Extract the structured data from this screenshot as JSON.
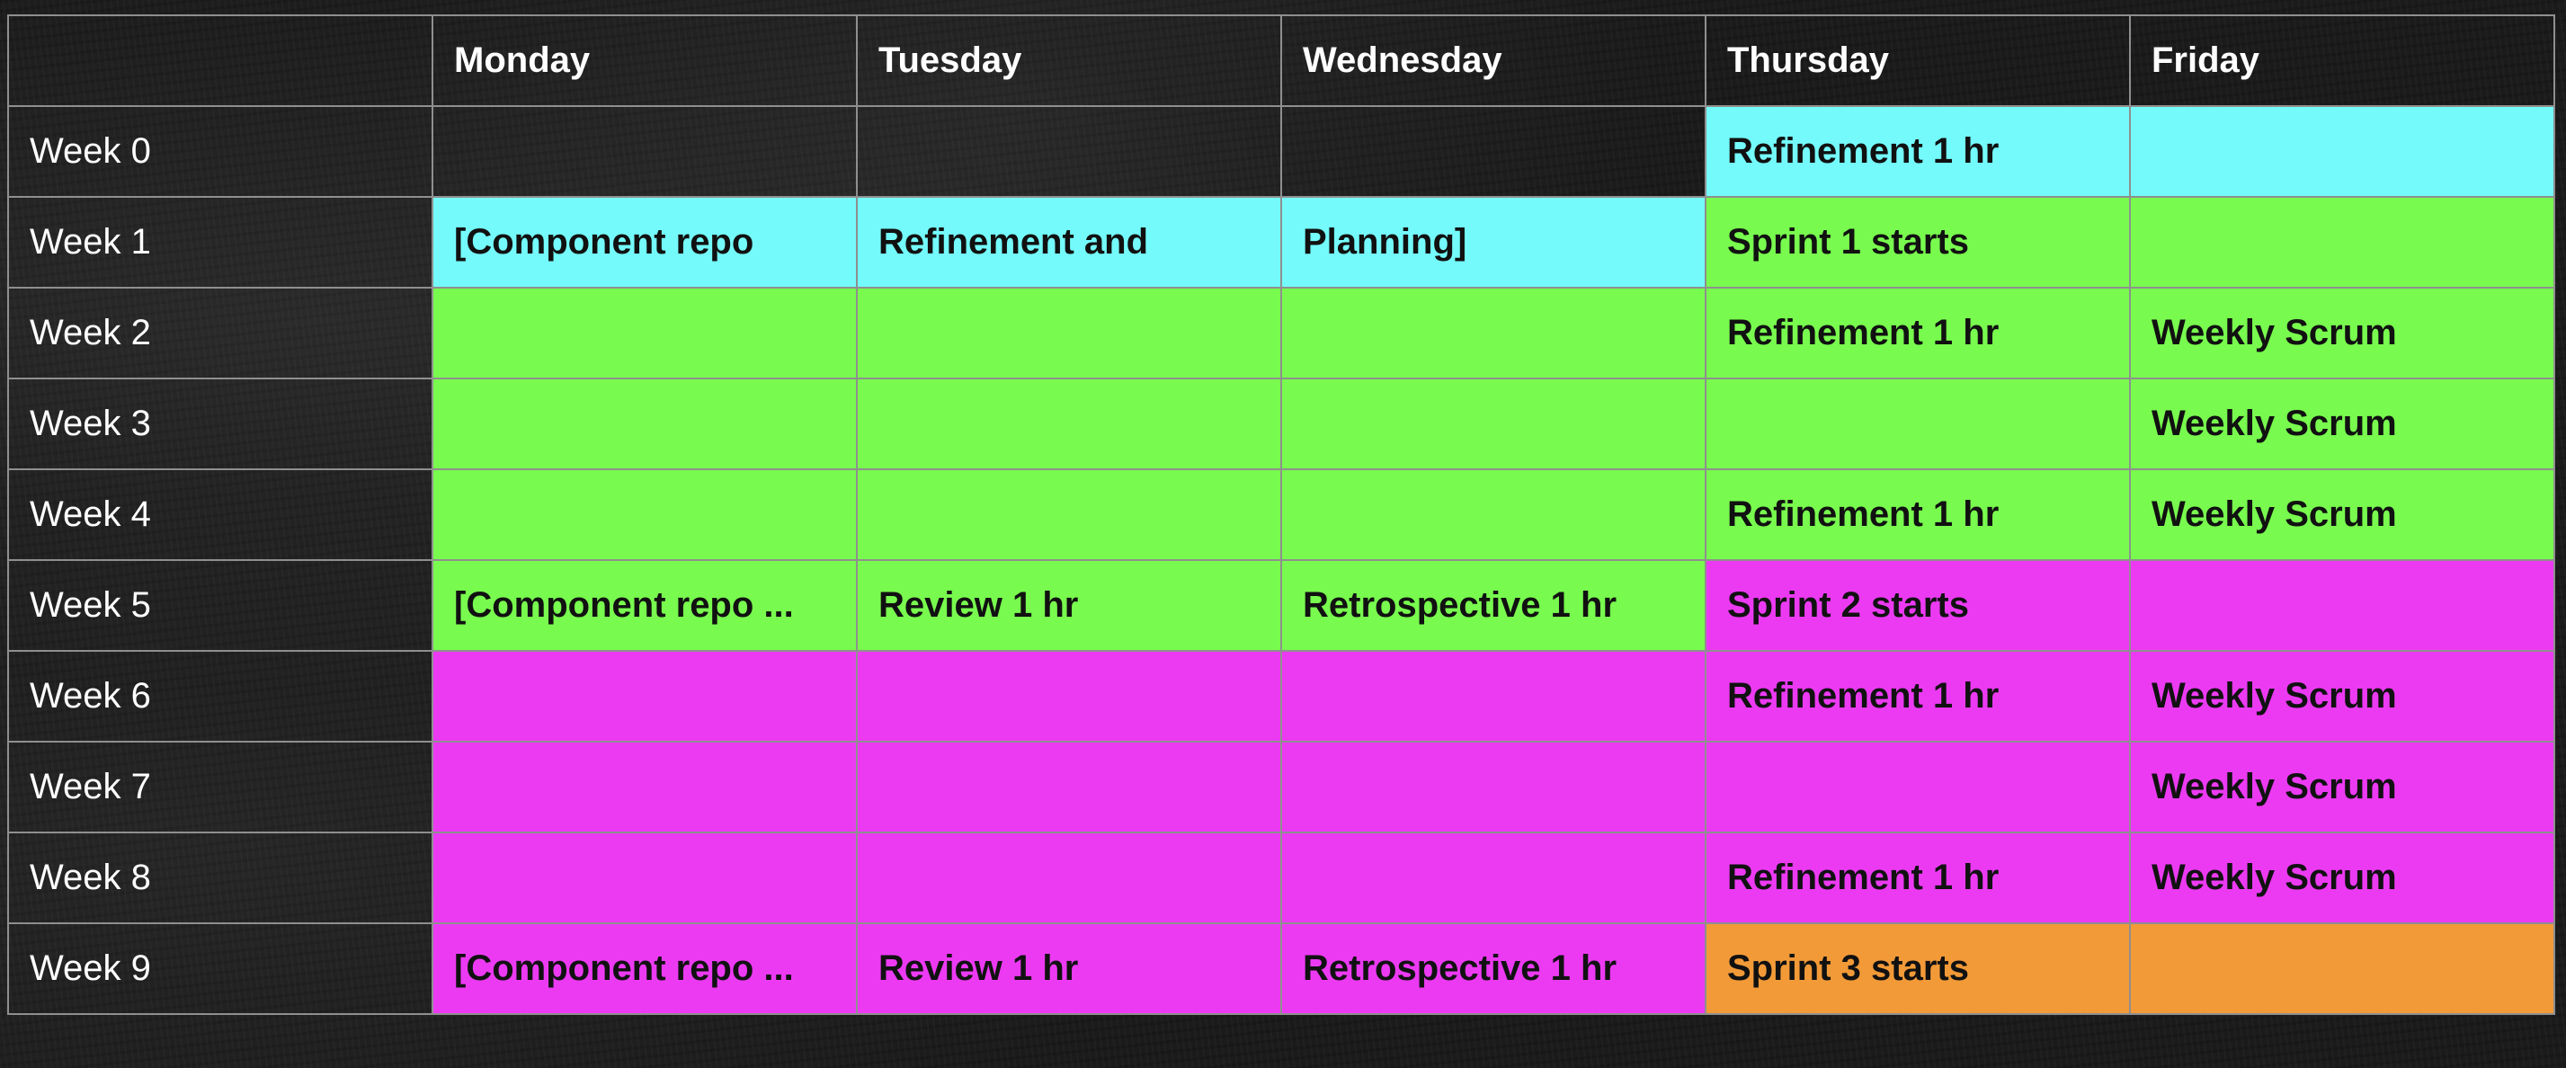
{
  "colors": {
    "empty": "transparent",
    "cyan": "#74fafa",
    "green": "#78fb4e",
    "magenta": "#ec3af3",
    "orange": "#f29a38"
  },
  "header": {
    "corner": "",
    "days": [
      "Monday",
      "Tuesday",
      "Wednesday",
      "Thursday",
      "Friday"
    ]
  },
  "rows": [
    {
      "label": "Week 0",
      "cells": [
        {
          "text": "",
          "color": "empty"
        },
        {
          "text": "",
          "color": "empty"
        },
        {
          "text": "",
          "color": "empty"
        },
        {
          "text": "Refinement 1 hr",
          "color": "cyan"
        },
        {
          "text": "",
          "color": "cyan"
        }
      ]
    },
    {
      "label": "Week 1",
      "cells": [
        {
          "text": "[Component repo",
          "color": "cyan"
        },
        {
          "text": "Refinement and",
          "color": "cyan"
        },
        {
          "text": "Planning]",
          "color": "cyan"
        },
        {
          "text": "Sprint 1 starts",
          "color": "green"
        },
        {
          "text": "",
          "color": "green"
        }
      ]
    },
    {
      "label": "Week 2",
      "cells": [
        {
          "text": "",
          "color": "green"
        },
        {
          "text": "",
          "color": "green"
        },
        {
          "text": "",
          "color": "green"
        },
        {
          "text": "Refinement 1 hr",
          "color": "green"
        },
        {
          "text": "Weekly Scrum",
          "color": "green"
        }
      ]
    },
    {
      "label": "Week 3",
      "cells": [
        {
          "text": "",
          "color": "green"
        },
        {
          "text": "",
          "color": "green"
        },
        {
          "text": "",
          "color": "green"
        },
        {
          "text": "",
          "color": "green"
        },
        {
          "text": "Weekly Scrum",
          "color": "green"
        }
      ]
    },
    {
      "label": "Week 4",
      "cells": [
        {
          "text": "",
          "color": "green"
        },
        {
          "text": "",
          "color": "green"
        },
        {
          "text": "",
          "color": "green"
        },
        {
          "text": "Refinement 1 hr",
          "color": "green"
        },
        {
          "text": "Weekly Scrum",
          "color": "green"
        }
      ]
    },
    {
      "label": "Week 5",
      "cells": [
        {
          "text": "[Component repo ...",
          "color": "green"
        },
        {
          "text": "Review 1 hr",
          "color": "green"
        },
        {
          "text": "Retrospective 1 hr",
          "color": "green"
        },
        {
          "text": "Sprint 2 starts",
          "color": "magenta"
        },
        {
          "text": "",
          "color": "magenta"
        }
      ]
    },
    {
      "label": "Week 6",
      "cells": [
        {
          "text": "",
          "color": "magenta"
        },
        {
          "text": "",
          "color": "magenta"
        },
        {
          "text": "",
          "color": "magenta"
        },
        {
          "text": "Refinement 1 hr",
          "color": "magenta"
        },
        {
          "text": "Weekly Scrum",
          "color": "magenta"
        }
      ]
    },
    {
      "label": "Week 7",
      "cells": [
        {
          "text": "",
          "color": "magenta"
        },
        {
          "text": "",
          "color": "magenta"
        },
        {
          "text": "",
          "color": "magenta"
        },
        {
          "text": "",
          "color": "magenta"
        },
        {
          "text": "Weekly Scrum",
          "color": "magenta"
        }
      ]
    },
    {
      "label": "Week 8",
      "cells": [
        {
          "text": "",
          "color": "magenta"
        },
        {
          "text": "",
          "color": "magenta"
        },
        {
          "text": "",
          "color": "magenta"
        },
        {
          "text": "Refinement 1 hr",
          "color": "magenta"
        },
        {
          "text": "Weekly Scrum",
          "color": "magenta"
        }
      ]
    },
    {
      "label": "Week 9",
      "cells": [
        {
          "text": "[Component repo ...",
          "color": "magenta"
        },
        {
          "text": "Review 1 hr",
          "color": "magenta"
        },
        {
          "text": "Retrospective 1 hr",
          "color": "magenta"
        },
        {
          "text": "Sprint 3 starts",
          "color": "orange"
        },
        {
          "text": "",
          "color": "orange"
        }
      ]
    }
  ]
}
